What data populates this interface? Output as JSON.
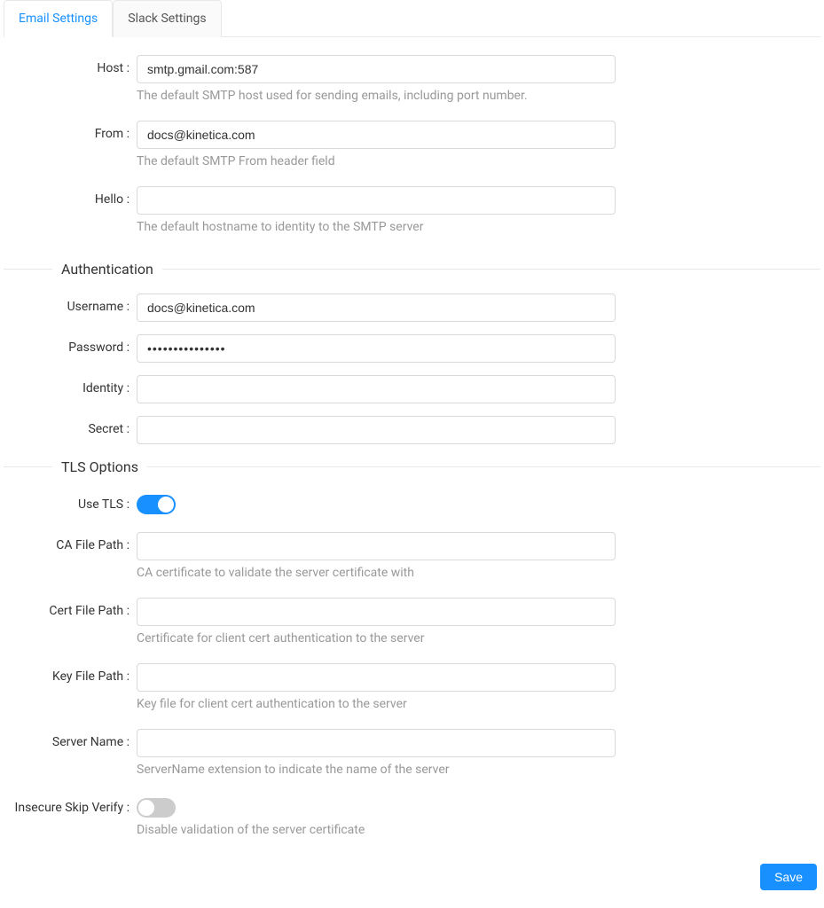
{
  "tabs": {
    "email": "Email Settings",
    "slack": "Slack Settings"
  },
  "fields": {
    "host": {
      "label": "Host",
      "value": "smtp.gmail.com:587",
      "help": "The default SMTP host used for sending emails, including port number."
    },
    "from": {
      "label": "From",
      "value": "docs@kinetica.com",
      "help": "The default SMTP From header field"
    },
    "hello": {
      "label": "Hello",
      "value": "",
      "help": "The default hostname to identity to the SMTP server"
    }
  },
  "sections": {
    "auth": "Authentication",
    "tls": "TLS Options"
  },
  "auth": {
    "username": {
      "label": "Username",
      "value": "docs@kinetica.com"
    },
    "password": {
      "label": "Password",
      "value": "•••••••••••••••"
    },
    "identity": {
      "label": "Identity",
      "value": ""
    },
    "secret": {
      "label": "Secret",
      "value": ""
    }
  },
  "tls": {
    "use_tls": {
      "label": "Use TLS",
      "on": true
    },
    "ca": {
      "label": "CA File Path",
      "value": "",
      "help": "CA certificate to validate the server certificate with"
    },
    "cert": {
      "label": "Cert File Path",
      "value": "",
      "help": "Certificate for client cert authentication to the server"
    },
    "key": {
      "label": "Key File Path",
      "value": "",
      "help": "Key file for client cert authentication to the server"
    },
    "server": {
      "label": "Server Name",
      "value": "",
      "help": "ServerName extension to indicate the name of the server"
    },
    "skip": {
      "label": "Insecure Skip Verify",
      "on": false,
      "help": "Disable validation of the server certificate"
    }
  },
  "buttons": {
    "save": "Save"
  }
}
